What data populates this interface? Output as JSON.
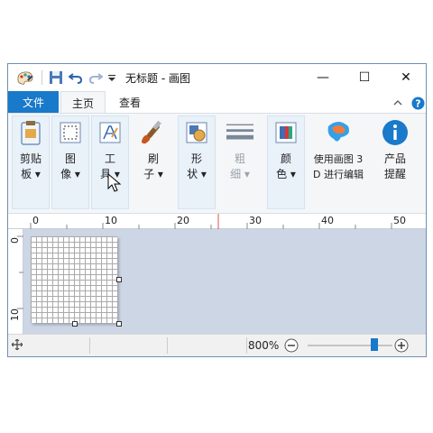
{
  "window": {
    "title": "无标题 - 画图"
  },
  "window_controls": {
    "minimize": "—",
    "maximize": "☐",
    "close": "✕"
  },
  "tabs": {
    "file": "文件",
    "home": "主页",
    "view": "查看"
  },
  "ribbon": {
    "clipboard": "剪贴\n板 ▾",
    "image": "图\n像 ▾",
    "tools": "工\n具 ▾",
    "brushes": "刷\n子 ▾",
    "shapes": "形\n状 ▾",
    "size": "粗\n细 ▾",
    "colors": "颜\n色 ▾",
    "paint3d": "使用画图 3\nD 进行编辑",
    "product_alert": "产品\n提醒"
  },
  "ruler": {
    "h_ticks": [
      "0",
      "10",
      "20",
      "30",
      "40",
      "50"
    ],
    "v_ticks": [
      "0",
      "10"
    ]
  },
  "status": {
    "zoom": "800%"
  },
  "zoom_slider": {
    "level_fraction": 0.79
  },
  "colors": {
    "accent": "#1979ca",
    "canvas_bg": "#cdd6e4",
    "ribbon_bg": "#f5f6f7"
  }
}
